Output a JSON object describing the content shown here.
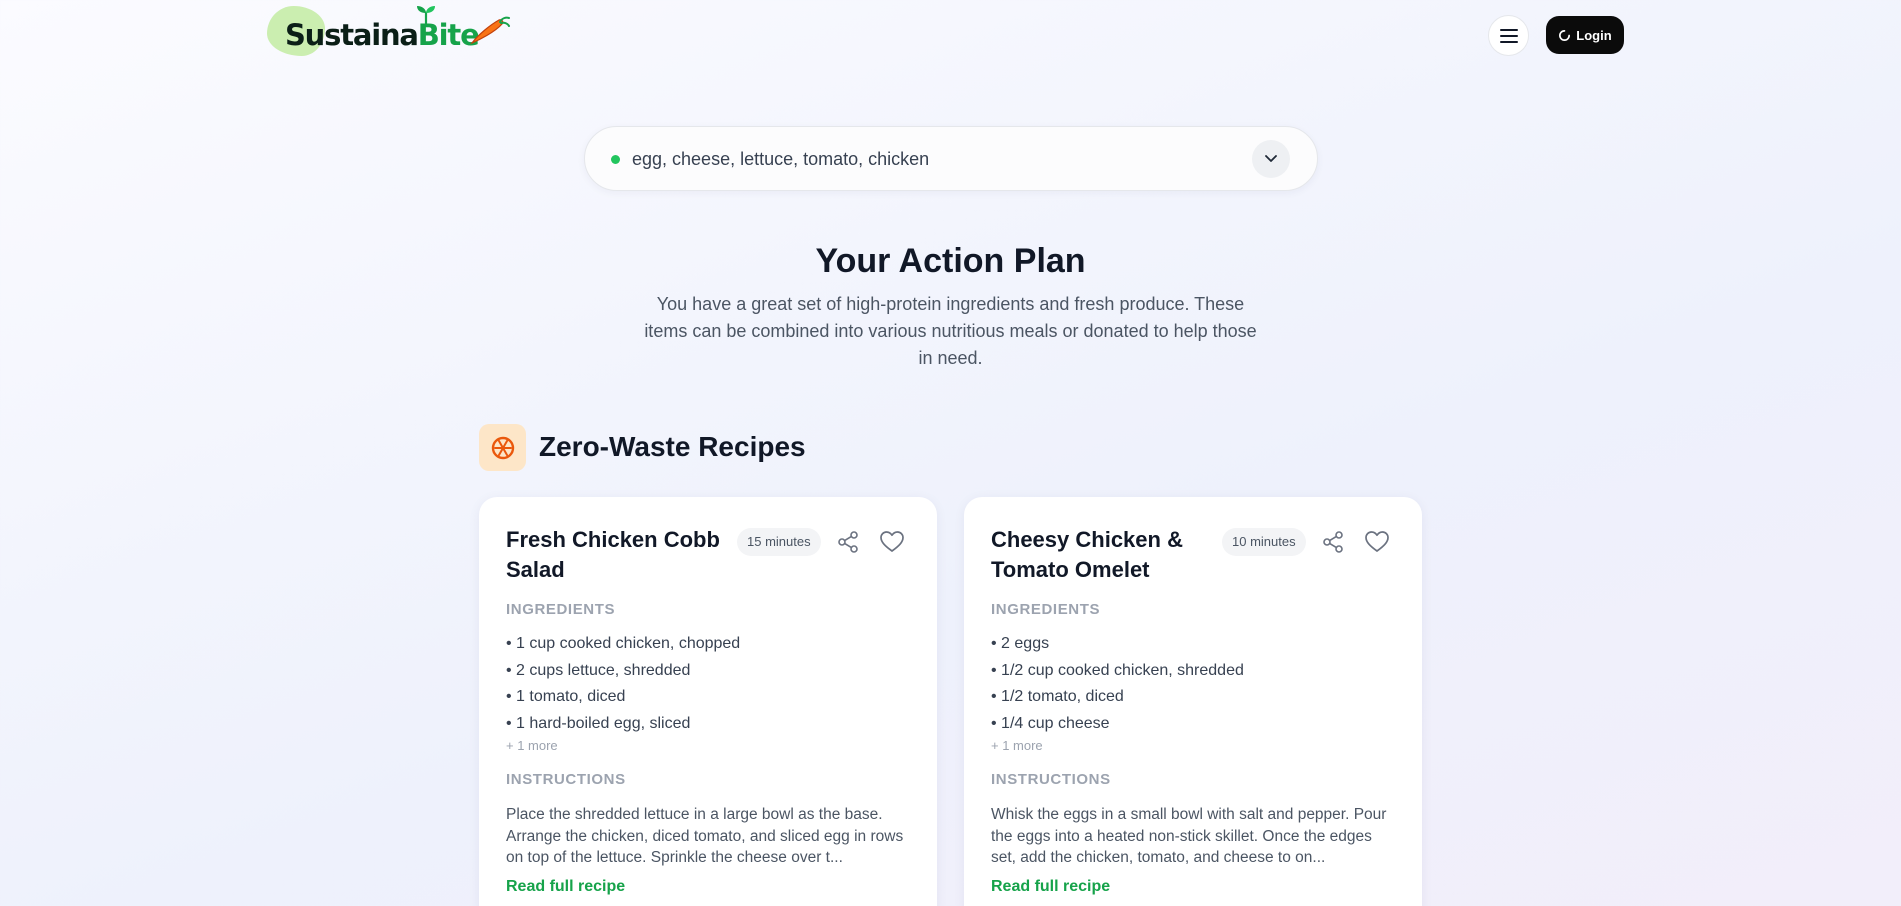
{
  "header": {
    "brand_part1": "Sustaina",
    "brand_part2": "Bite",
    "menu_icon": "hamburger-icon",
    "login_label": "Login"
  },
  "search": {
    "value": "egg, cheese, lettuce, tomato, chicken",
    "status_color": "#22c55e"
  },
  "plan": {
    "title": "Your Action Plan",
    "description": "You have a great set of high-protein ingredients and fresh produce. These items can be combined into various nutritious meals or donated to help those in need."
  },
  "recipes_section": {
    "title": "Zero-Waste Recipes",
    "icon": "recipe-icon",
    "cards": [
      {
        "title": "Fresh Chicken Cobb Salad",
        "time": "15 minutes",
        "ingredients_label": "INGREDIENTS",
        "ingredients": [
          "• 1 cup cooked chicken, chopped",
          "• 2 cups lettuce, shredded",
          "• 1 tomato, diced",
          "• 1 hard-boiled egg, sliced"
        ],
        "more": "+ 1 more",
        "instructions_label": "INSTRUCTIONS",
        "instructions": "Place the shredded lettuce in a large bowl as the base. Arrange the chicken, diced tomato, and sliced egg in rows on top of the lettuce. Sprinkle the cheese over t...",
        "read_more": "Read full recipe"
      },
      {
        "title": "Cheesy Chicken & Tomato Omelet",
        "time": "10 minutes",
        "ingredients_label": "INGREDIENTS",
        "ingredients": [
          "• 2 eggs",
          "• 1/2 cup cooked chicken, shredded",
          "• 1/2 tomato, diced",
          "• 1/4 cup cheese"
        ],
        "more": "+ 1 more",
        "instructions_label": "INSTRUCTIONS",
        "instructions": "Whisk the eggs in a small bowl with salt and pepper. Pour the eggs into a heated non-stick skillet. Once the edges set, add the chicken, tomato, and cheese to on...",
        "read_more": "Read full recipe"
      }
    ]
  },
  "colors": {
    "accent_green": "#16a34a",
    "login_bg": "#0b0b0b",
    "section_icon_bg": "#fde6c8",
    "section_icon_fg": "#ea580c"
  }
}
